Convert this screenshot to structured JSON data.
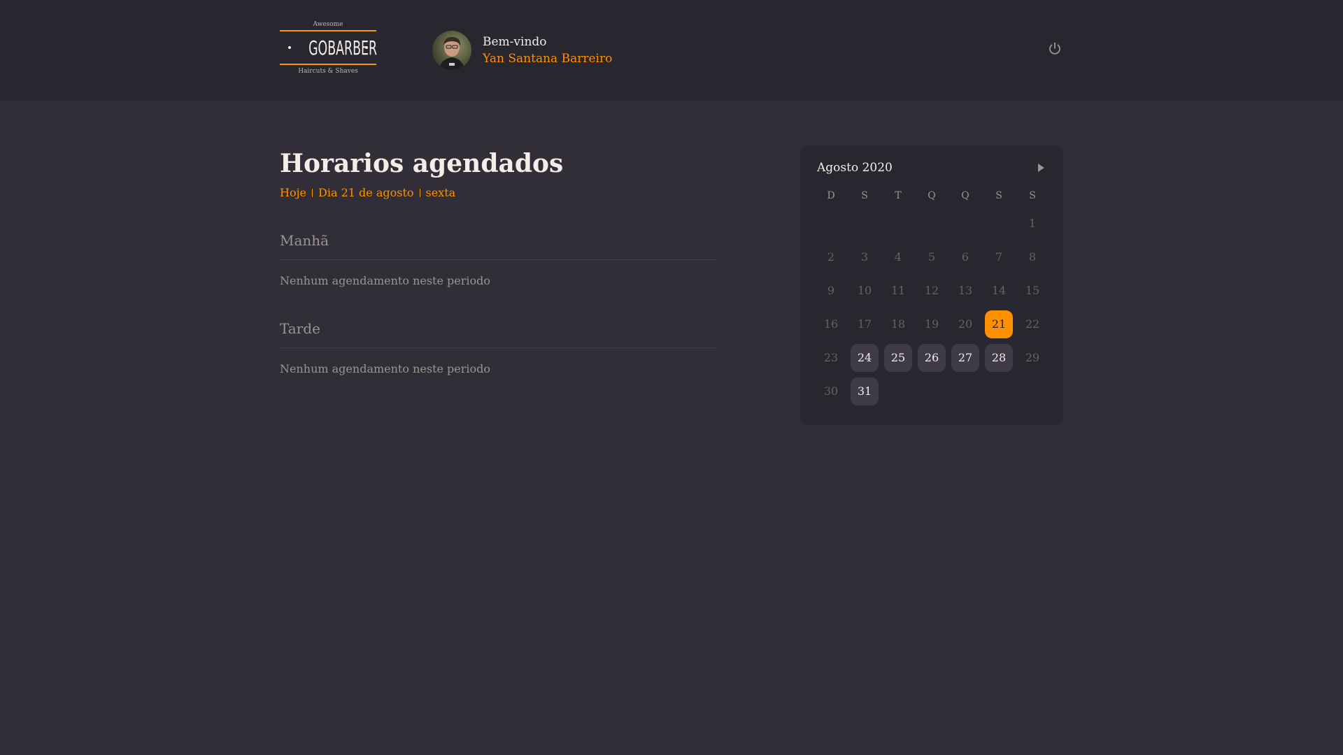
{
  "logo": {
    "top_text": "Awesome",
    "brand": "GOBARBER",
    "bottom_text": "Haircuts & Shaves"
  },
  "profile": {
    "welcome": "Bem-vindo",
    "name": "Yan Santana Barreiro"
  },
  "header": {
    "logout_icon": "power-icon"
  },
  "schedule": {
    "title": "Horarios agendados",
    "date": {
      "today": "Hoje",
      "day": "Dia 21 de agosto",
      "weekday": "sexta"
    },
    "morning": {
      "title": "Manhã",
      "empty": "Nenhum agendamento neste periodo"
    },
    "afternoon": {
      "title": "Tarde",
      "empty": "Nenhum agendamento neste periodo"
    }
  },
  "calendar": {
    "month": "Agosto 2020",
    "next_icon": "play-icon",
    "weekdays": [
      "D",
      "S",
      "T",
      "Q",
      "Q",
      "S",
      "S"
    ],
    "days": [
      {
        "label": "",
        "state": "empty"
      },
      {
        "label": "",
        "state": "empty"
      },
      {
        "label": "",
        "state": "empty"
      },
      {
        "label": "",
        "state": "empty"
      },
      {
        "label": "",
        "state": "empty"
      },
      {
        "label": "",
        "state": "empty"
      },
      {
        "label": "1",
        "state": "disabled"
      },
      {
        "label": "2",
        "state": "disabled"
      },
      {
        "label": "3",
        "state": "disabled"
      },
      {
        "label": "4",
        "state": "disabled"
      },
      {
        "label": "5",
        "state": "disabled"
      },
      {
        "label": "6",
        "state": "disabled"
      },
      {
        "label": "7",
        "state": "disabled"
      },
      {
        "label": "8",
        "state": "disabled"
      },
      {
        "label": "9",
        "state": "disabled"
      },
      {
        "label": "10",
        "state": "disabled"
      },
      {
        "label": "11",
        "state": "disabled"
      },
      {
        "label": "12",
        "state": "disabled"
      },
      {
        "label": "13",
        "state": "disabled"
      },
      {
        "label": "14",
        "state": "disabled"
      },
      {
        "label": "15",
        "state": "disabled"
      },
      {
        "label": "16",
        "state": "disabled"
      },
      {
        "label": "17",
        "state": "disabled"
      },
      {
        "label": "18",
        "state": "disabled"
      },
      {
        "label": "19",
        "state": "disabled"
      },
      {
        "label": "20",
        "state": "disabled"
      },
      {
        "label": "21",
        "state": "selected"
      },
      {
        "label": "22",
        "state": "disabled"
      },
      {
        "label": "23",
        "state": "disabled"
      },
      {
        "label": "24",
        "state": "available"
      },
      {
        "label": "25",
        "state": "available"
      },
      {
        "label": "26",
        "state": "available"
      },
      {
        "label": "27",
        "state": "available"
      },
      {
        "label": "28",
        "state": "available"
      },
      {
        "label": "29",
        "state": "disabled"
      },
      {
        "label": "30",
        "state": "disabled"
      },
      {
        "label": "31",
        "state": "available"
      }
    ]
  },
  "colors": {
    "background": "#312e38",
    "header": "#28262e",
    "accent": "#ff9000",
    "text": "#f4ede8",
    "muted": "#999591",
    "disabled": "#666360",
    "day_available": "#3e3b47"
  }
}
